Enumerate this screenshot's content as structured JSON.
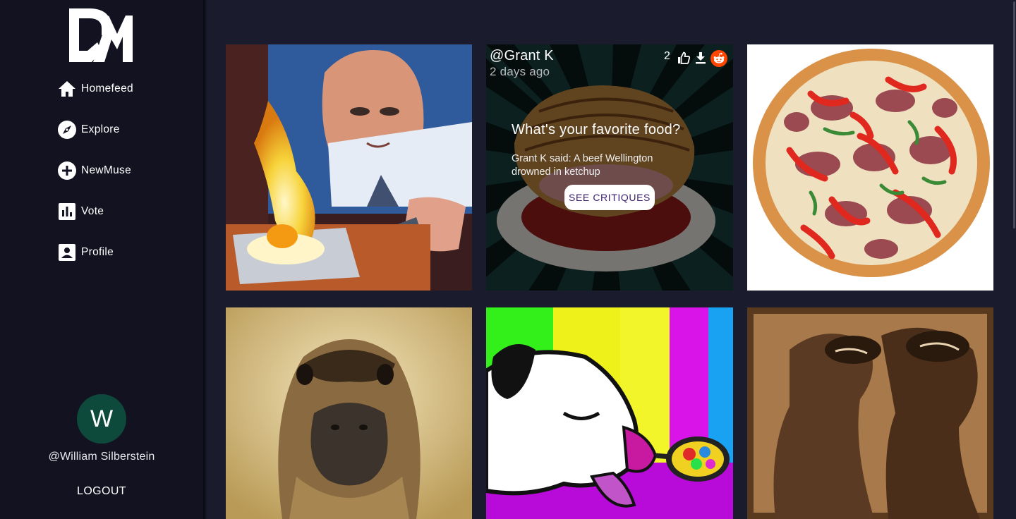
{
  "app": {
    "logo_text": "DM"
  },
  "sidebar": {
    "items": [
      {
        "label": "Homefeed",
        "icon": "home-icon"
      },
      {
        "label": "Explore",
        "icon": "compass-icon"
      },
      {
        "label": "NewMuse",
        "icon": "add-circle-icon"
      },
      {
        "label": "Vote",
        "icon": "bar-chart-icon"
      },
      {
        "label": "Profile",
        "icon": "profile-card-icon"
      }
    ],
    "avatar_initial": "W",
    "username": "@William Silberstein",
    "logout_label": "LOGOUT"
  },
  "feed": {
    "hovered_post": {
      "user": "@Grant K",
      "time": "2 days ago",
      "likes": "2",
      "question": "What's your favorite food?",
      "critique": "Grant K said: A beef Wellington drowned in ketchup",
      "button_label": "SEE CRITIQUES"
    },
    "posts": [
      {
        "subject": "man frying egg painting"
      },
      {
        "subject": "beef wellington with ketchup"
      },
      {
        "subject": "pizza"
      },
      {
        "subject": "duckling portrait"
      },
      {
        "subject": "pop art dog with spoon"
      },
      {
        "subject": "sepia dogs photo"
      }
    ]
  },
  "colors": {
    "background": "#1b1b2e",
    "sidebar": "#121220",
    "avatar": "#0e4a3b",
    "button_text": "#3a1f6e",
    "reddit": "#ff4500"
  }
}
